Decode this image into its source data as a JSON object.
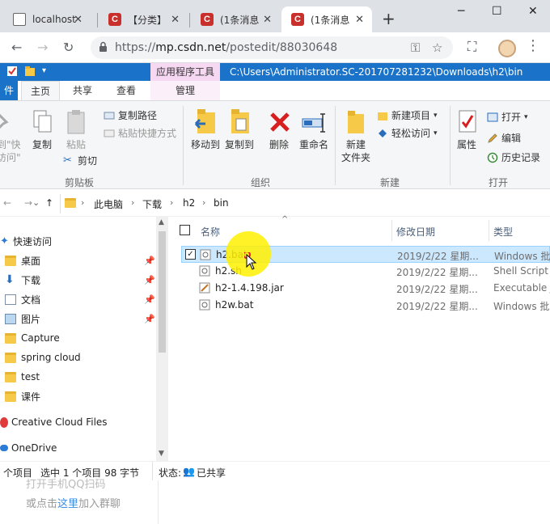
{
  "browser": {
    "tabs": [
      {
        "label": "localhost",
        "favicon": "page-icon"
      },
      {
        "label": "【分类】",
        "favicon": "csdn-icon"
      },
      {
        "label": "(1条消息",
        "favicon": "csdn-icon"
      },
      {
        "label": "(1条消息",
        "favicon": "csdn-icon",
        "active": true
      }
    ],
    "favicon_letter": "C",
    "new_tab": "+",
    "url_host": "mp.csdn.net",
    "url_prefix": "https://",
    "url_path": "/postedit/88030648",
    "window_buttons": {
      "minimize": "─",
      "maximize": "☐",
      "close": "✕"
    }
  },
  "explorer": {
    "context_tool": "应用程序工具",
    "title_path": "C:\\Users\\Administrator.SC-201707281232\\Downloads\\h2\\bin",
    "ribbon_tabs": {
      "file": "件",
      "home": "主页",
      "share": "共享",
      "view": "查看",
      "manage": "管理"
    },
    "ribbon": {
      "pin_quick": "到\"快\n访问\"",
      "copy": "复制",
      "paste": "粘贴",
      "copy_path": "复制路径",
      "paste_shortcut": "粘贴快捷方式",
      "cut": "剪切",
      "clipboard_group": "剪贴板",
      "move_to": "移动到",
      "copy_to": "复制到",
      "delete": "删除",
      "rename": "重命名",
      "organize_group": "组织",
      "new_folder_line1": "新建",
      "new_folder_line2": "文件夹",
      "new_item": "新建项目",
      "easy_access": "轻松访问",
      "new_group": "新建",
      "properties": "属性",
      "open": "打开",
      "edit": "编辑",
      "history": "历史记录",
      "open_group": "打开"
    },
    "breadcrumb": [
      "此电脑",
      "下载",
      "h2",
      "bin"
    ],
    "nav": {
      "quick_access": "快速访问",
      "items": [
        {
          "label": "桌面",
          "icon": "desktop-folder-icon",
          "pinned": true
        },
        {
          "label": "下载",
          "icon": "download-arrow-icon",
          "pinned": true
        },
        {
          "label": "文档",
          "icon": "documents-icon",
          "pinned": true
        },
        {
          "label": "图片",
          "icon": "pictures-icon",
          "pinned": true
        },
        {
          "label": "Capture",
          "icon": "folder-icon",
          "pinned": false
        },
        {
          "label": "spring cloud",
          "icon": "folder-icon",
          "pinned": false
        },
        {
          "label": "test",
          "icon": "folder-icon",
          "pinned": false
        },
        {
          "label": "课件",
          "icon": "folder-icon",
          "pinned": false
        }
      ],
      "creative_cloud": "Creative Cloud Files",
      "onedrive": "OneDrive"
    },
    "columns": {
      "name": "名称",
      "modified": "修改日期",
      "type": "类型"
    },
    "files": [
      {
        "name": "h2.bat",
        "date": "2019/2/22 星期...",
        "type": "Windows 批",
        "icon": "batch-file-icon",
        "selected": true
      },
      {
        "name": "h2.sh",
        "date": "2019/2/22 星期...",
        "type": "Shell Script",
        "icon": "script-file-icon",
        "selected": false
      },
      {
        "name": "h2-1.4.198.jar",
        "date": "2019/2/22 星期...",
        "type": "Executable J",
        "icon": "jar-file-icon",
        "selected": false
      },
      {
        "name": "h2w.bat",
        "date": "2019/2/22 星期...",
        "type": "Windows 批",
        "icon": "batch-file-icon",
        "selected": false
      }
    ],
    "status": {
      "items_count": "个项目",
      "selected": "选中 1 个项目 98 字节",
      "state": "状态:",
      "shared": "已共享"
    }
  },
  "web": {
    "line1": "打开手机QQ扫码",
    "line2_a": "或点击",
    "line2_link": "这里",
    "line2_b": "加入群聊"
  },
  "colors": {
    "title_blue": "#1a73c8",
    "selection": "#cce8ff",
    "csdn_red": "#c9302c",
    "highlight": "#fff000"
  }
}
